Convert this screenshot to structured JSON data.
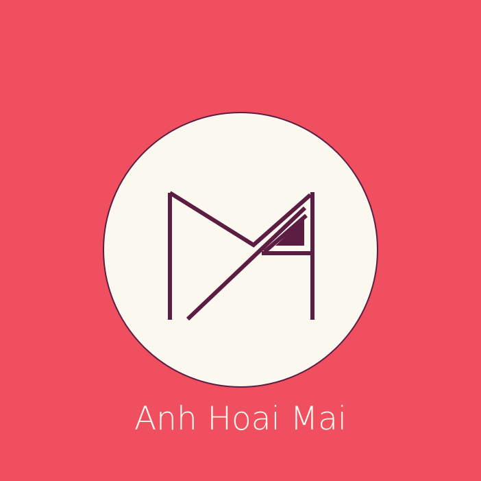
{
  "brand": {
    "name": "Anh Hoai Mai",
    "monogram_icon": "am-monogram-icon"
  },
  "colors": {
    "background": "#ef4f5f",
    "badge_fill": "#fbf8f0",
    "monogram": "#5c1d43",
    "text": "#fbf8f0"
  }
}
